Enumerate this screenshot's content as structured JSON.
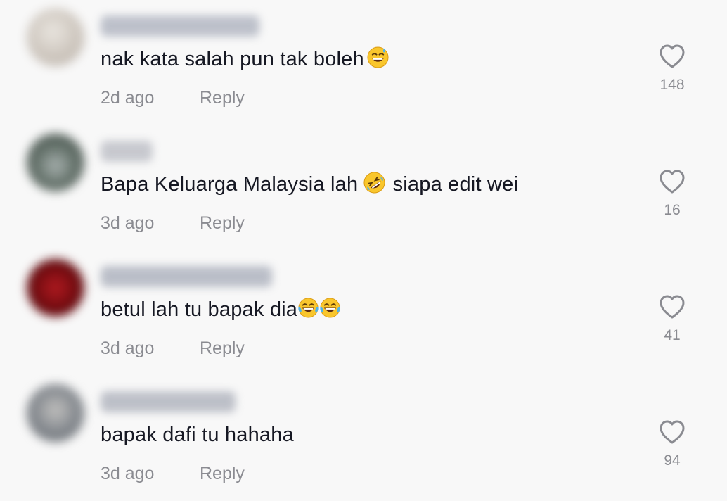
{
  "comments": [
    {
      "text": "nak kata salah pun tak boleh",
      "emoji_after": [
        "grinning-sweat-emoji"
      ],
      "text_after": "",
      "time": "2d ago",
      "reply_label": "Reply",
      "likes": "148",
      "avatar_colors": [
        "#d6d2cc",
        "#b9b0a7",
        "#e6e1da"
      ],
      "username_color": "#a9aebb"
    },
    {
      "text": "Bapa Keluarga Malaysia lah",
      "emoji_after": [
        "rofl-emoji"
      ],
      "text_after": " siapa edit wei",
      "time": "3d ago",
      "reply_label": "Reply",
      "likes": "16",
      "avatar_colors": [
        "#2f3b35",
        "#6d7d77",
        "#a7b1b0"
      ],
      "username_color": "#b7b9c1"
    },
    {
      "text": "betul lah tu bapak dia",
      "emoji_after": [
        "tears-of-joy-emoji",
        "tears-of-joy-emoji"
      ],
      "text_after": "",
      "time": "3d ago",
      "reply_label": "Reply",
      "likes": "41",
      "avatar_colors": [
        "#7a0d12",
        "#3a0608",
        "#b21a20"
      ],
      "username_color": "#a6abb8"
    },
    {
      "text": "bapak dafi tu hahaha",
      "emoji_after": [],
      "text_after": "",
      "time": "3d ago",
      "reply_label": "Reply",
      "likes": "94",
      "avatar_colors": [
        "#545a60",
        "#8c9095",
        "#c2c1bf"
      ],
      "username_color": "#a9adb8"
    }
  ],
  "colors": {
    "background": "#f8f8f8",
    "text": "#161823",
    "muted": "#8a8b91"
  }
}
